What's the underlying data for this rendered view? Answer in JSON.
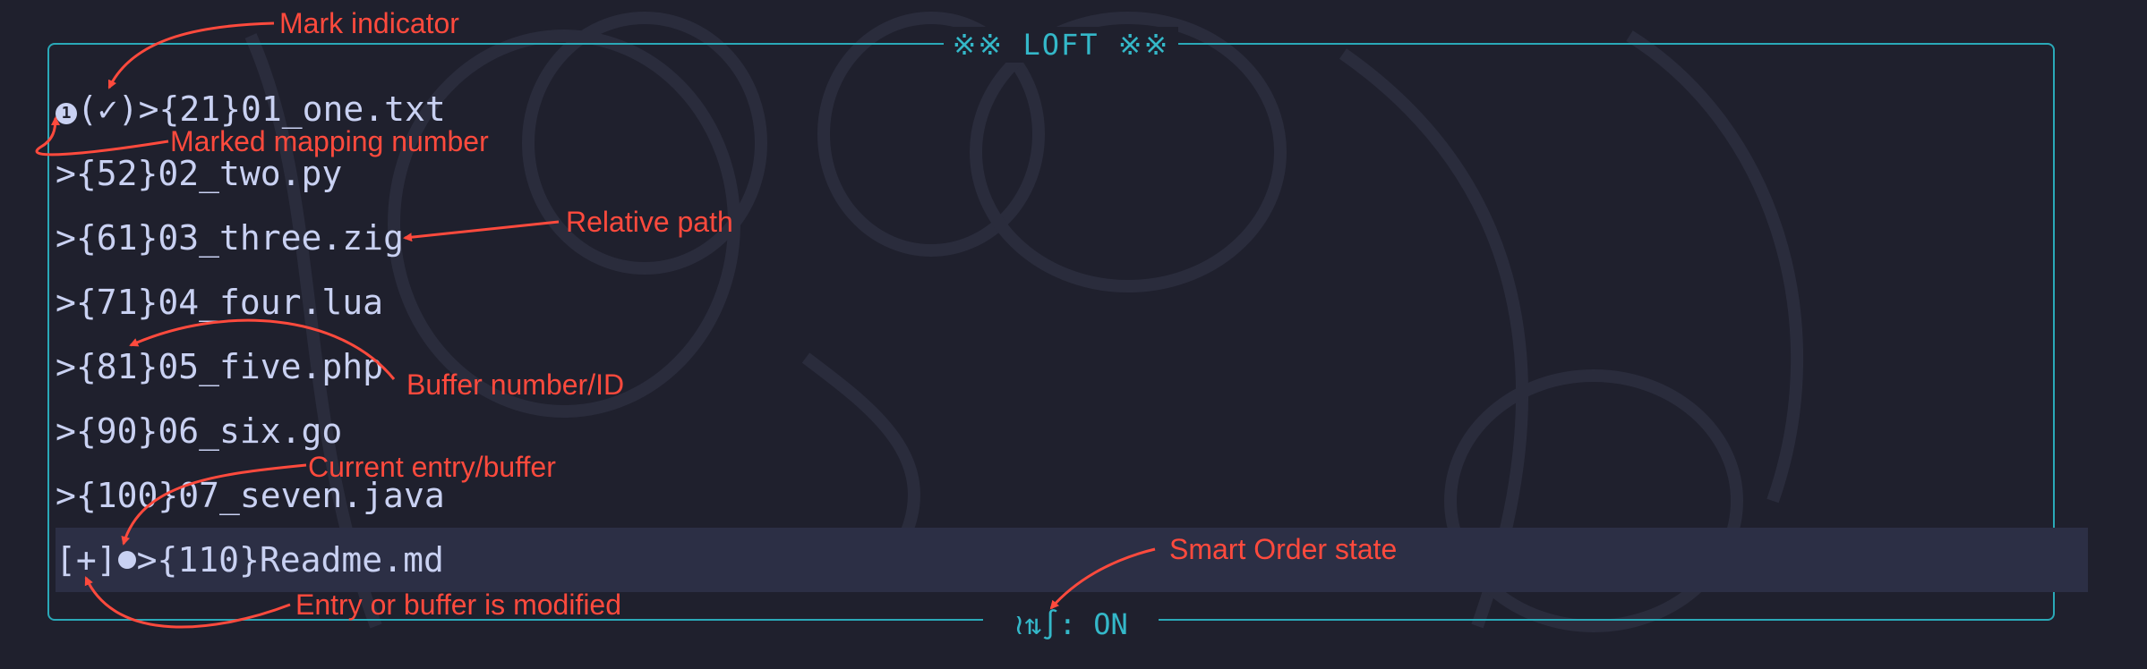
{
  "window": {
    "title": "※※ LOFT ※※",
    "footer": "≀⇅∫: ON"
  },
  "entries": [
    {
      "prefix": "(✓)>",
      "number": "{21}",
      "name": "01_one.txt",
      "mark": "1"
    },
    {
      "prefix": ">",
      "number": "{52}",
      "name": "02_two.py"
    },
    {
      "prefix": ">",
      "number": "{61}",
      "name": "03_three.zig"
    },
    {
      "prefix": ">",
      "number": "{71}",
      "name": "04_four.lua"
    },
    {
      "prefix": ">",
      "number": "{81}",
      "name": "05_five.php"
    },
    {
      "prefix": ">",
      "number": "{90}",
      "name": "06_six.go"
    },
    {
      "prefix": ">",
      "number": "{100}",
      "name": "07_seven.java"
    },
    {
      "modified": "[+]",
      "prefix": ">",
      "number": "{110}",
      "name": "Readme.md",
      "current": true
    }
  ],
  "annotations": {
    "mark_indicator": "Mark indicator",
    "marked_mapping_number": "Marked mapping number",
    "relative_path": "Relative path",
    "buffer_number": "Buffer number/ID",
    "current_entry": "Current entry/buffer",
    "smart_order": "Smart Order state",
    "modified": "Entry or buffer is modified"
  },
  "colors": {
    "background": "#1f202d",
    "border": "#2aa9b8",
    "text": "#c9d1f2",
    "current_row": "#2c2f45",
    "annotation": "#ff4a3d"
  }
}
